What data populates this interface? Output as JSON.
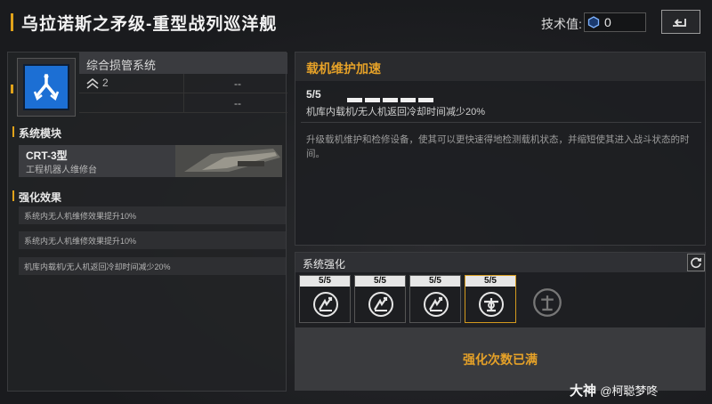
{
  "header": {
    "title": "乌拉诺斯之矛级-重型战列巡洋舰",
    "tech_label": "技术值:",
    "tech_value": "0"
  },
  "left_panel": {
    "system_name": "综合损管系统",
    "level": "2",
    "stat_placeholders": [
      "--",
      "--"
    ],
    "module_section_title": "系统模块",
    "module": {
      "name": "CRT-3型",
      "subtitle": "工程机器人维修台"
    },
    "effects_section_title": "强化效果",
    "effects": [
      "系统内无人机维修效果提升10%",
      "系统内无人机维修效果提升10%",
      "机库内载机/无人机返回冷却时间减少20%"
    ]
  },
  "detail_panel": {
    "title": "载机维护加速",
    "level": "5/5",
    "pips_filled": 5,
    "effect": "机库内载机/无人机返回冷却时间减少20%",
    "description": "升级载机维护和检修设备，使其可以更快速得地检测载机状态，并缩短使其进入战斗状态的时间。"
  },
  "enhance_panel": {
    "title": "系统强化",
    "slots": [
      {
        "count": "5/5",
        "icon": "repair-boost-icon",
        "selected": false
      },
      {
        "count": "5/5",
        "icon": "repair-boost-icon",
        "selected": false
      },
      {
        "count": "5/5",
        "icon": "repair-boost-icon",
        "selected": false
      },
      {
        "count": "5/5",
        "icon": "carrier-maintenance-icon",
        "selected": true
      }
    ],
    "locked_slot_icon": "locked-enhance-icon",
    "maxed_text": "强化次数已满"
  },
  "watermark": {
    "brand": "大神",
    "user": "@柯聪梦咚"
  },
  "colors": {
    "accent": "#e5a128",
    "system_icon_bg": "#1c6fd4"
  }
}
